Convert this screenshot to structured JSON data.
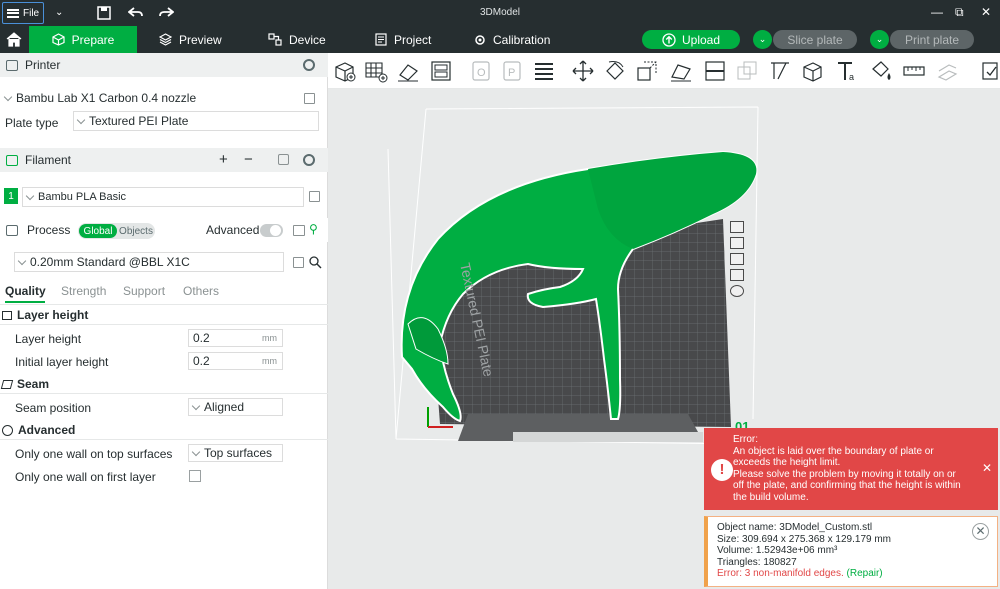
{
  "titlebar": {
    "file_label": "File",
    "title": "3DModel",
    "controls": [
      "—",
      "⧉",
      "✕"
    ]
  },
  "nav": {
    "tabs": [
      {
        "label": "Prepare",
        "active": true
      },
      {
        "label": "Preview",
        "active": false
      },
      {
        "label": "Device",
        "active": false
      },
      {
        "label": "Project",
        "active": false
      },
      {
        "label": "Calibration",
        "active": false
      }
    ],
    "upload_label": "Upload",
    "slice_label": "Slice plate",
    "print_label": "Print plate",
    "accent_color": "#00ae42"
  },
  "printer": {
    "section_title": "Printer",
    "selected_printer": "Bambu Lab X1 Carbon 0.4 nozzle",
    "plate_type_label": "Plate type",
    "plate_type_value": "Textured PEI Plate"
  },
  "filament": {
    "section_title": "Filament",
    "slot_number": "1",
    "selected": "Bambu PLA Basic",
    "slot_color": "#00ae42"
  },
  "process": {
    "section_title": "Process",
    "scope_options": [
      "Global",
      "Objects"
    ],
    "scope_selected": "Global",
    "advanced_label": "Advanced",
    "advanced_enabled": false,
    "preset": "0.20mm Standard @BBL X1C",
    "tabs": [
      "Quality",
      "Strength",
      "Support",
      "Others"
    ],
    "active_tab": "Quality",
    "groups": {
      "layer_height": {
        "title": "Layer height",
        "layer_height_label": "Layer height",
        "layer_height_value": "0.2",
        "initial_layer_height_label": "Initial layer height",
        "initial_layer_height_value": "0.2",
        "unit": "mm"
      },
      "seam": {
        "title": "Seam",
        "seam_position_label": "Seam position",
        "seam_position_value": "Aligned"
      },
      "advanced": {
        "title": "Advanced",
        "one_wall_top_label": "Only one wall on top surfaces",
        "one_wall_top_value": "Top surfaces",
        "one_wall_first_label": "Only one wall on first layer",
        "one_wall_first_checked": false
      }
    }
  },
  "viewport": {
    "plate_label": "Textured PEI Plate",
    "plate_number": "01",
    "model_color": "#00ae42"
  },
  "error": {
    "title": "Error:",
    "line1": "An object is laid over the boundary of plate or",
    "line2": "exceeds the height limit.",
    "line3": "Please solve the problem by moving it totally on or",
    "line4": "off the plate, and confirming that the height is within",
    "line5": "the build volume.",
    "color": "#e14747"
  },
  "object_info": {
    "name": "Object name: 3DModel_Custom.stl",
    "size": "Size: 309.694 x 275.368 x 129.179 mm",
    "volume": "Volume: 1.52943e+06 mm³",
    "triangles": "Triangles: 180827",
    "error_text": "Error: 3 non-manifold edges.",
    "repair_label": "(Repair)"
  }
}
